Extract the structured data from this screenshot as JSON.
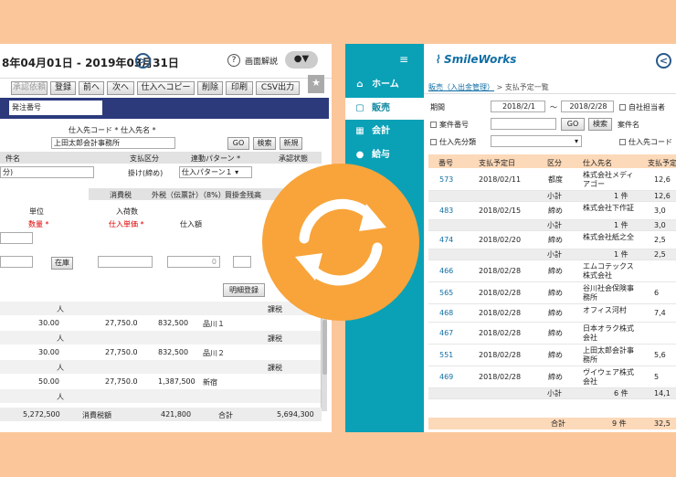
{
  "left_window": {
    "period": "8年04月01日 - 2019年03月31日",
    "help_label": "画面解説",
    "user_caret": "▼",
    "toolbar": [
      "承認依頼",
      "登録",
      "前へ",
      "次へ",
      "仕入へコピー",
      "削除",
      "印刷",
      "CSV出力"
    ],
    "order_label": "発注番号",
    "supplier_header": "仕入先コード * 仕入先名 *",
    "supplier_value": "上田太郎会計事務所",
    "go": "GO",
    "search": "検索",
    "new": "新規",
    "col_headers": [
      "件名",
      "支払区分",
      "連動パターン *",
      "承認状態"
    ],
    "case_value": "分)",
    "payment_value": "掛け(締め)",
    "pattern_value": "仕入パターン１",
    "tax_label": "消費税",
    "tax_value": "外税（伝票計）（8%）",
    "balance_label": "買掛金残高",
    "detail_headers": [
      "単位",
      "入荷数",
      "数量 *",
      "仕入単価 *",
      "仕入額"
    ],
    "stock_button": "在庫",
    "zero_value": "0",
    "detail_register": "明細登録",
    "rows": [
      {
        "unit": "人",
        "tax": "課税",
        "qty": "30.00",
        "price": "27,750.0",
        "amount": "832,500",
        "note": "品川１"
      },
      {
        "unit": "人",
        "tax": "課税",
        "qty": "30.00",
        "price": "27,750.0",
        "amount": "832,500",
        "note": "品川２"
      },
      {
        "unit": "人",
        "tax": "課税",
        "qty": "50.00",
        "price": "27,750.0",
        "amount": "1,387,500",
        "note": "新宿"
      },
      {
        "unit": "人",
        "tax": "",
        "qty": "",
        "price": "",
        "amount": "",
        "note": ""
      }
    ],
    "footer": {
      "subtotal": "5,272,500",
      "tax_label": "消費税額",
      "tax": "421,800",
      "total_label": "合計",
      "total": "5,694,300"
    }
  },
  "right_window": {
    "menu": [
      "ホーム",
      "販売",
      "会計",
      "給与"
    ],
    "logo": "SmileWorks",
    "breadcrumb_link": "販売（入出金管理）",
    "breadcrumb_rest": " > 支払予定一覧",
    "period_label": "期間",
    "date_from": "2018/2/1",
    "tilde": "～",
    "date_to": "2018/2/28",
    "own_staff": "自社担当者",
    "case_no": "案件番号",
    "go": "GO",
    "search": "検索",
    "case_name": "案件名",
    "supplier_class": "仕入先分類",
    "supplier_code": "仕入先コード",
    "headers": [
      "番号",
      "支払予定日",
      "区分",
      "仕入先名",
      "支払予定"
    ],
    "rows": [
      {
        "no": "573",
        "date": "2018/02/11",
        "kind": "都度",
        "name": "株式会社メディアゴー",
        "amt": "12,6"
      },
      {
        "sub": true,
        "label": "小計",
        "count": "1 件",
        "amt": "12,6"
      },
      {
        "no": "483",
        "date": "2018/02/15",
        "kind": "締め",
        "name": "株式会社下作証",
        "amt": "3,0"
      },
      {
        "sub": true,
        "label": "小計",
        "count": "1 件",
        "amt": "3,0"
      },
      {
        "no": "474",
        "date": "2018/02/20",
        "kind": "締め",
        "name": "株式会社紙之全",
        "amt": "2,5"
      },
      {
        "sub": true,
        "label": "小計",
        "count": "1 件",
        "amt": "2,5"
      },
      {
        "no": "466",
        "date": "2018/02/28",
        "kind": "締め",
        "name": "エムコテックス株式会社",
        "amt": ""
      },
      {
        "no": "565",
        "date": "2018/02/28",
        "kind": "締め",
        "name": "谷川社会保険事務所",
        "amt": "6"
      },
      {
        "no": "468",
        "date": "2018/02/28",
        "kind": "締め",
        "name": "オフィス河村",
        "amt": "7,4"
      },
      {
        "no": "467",
        "date": "2018/02/28",
        "kind": "締め",
        "name": "日本オラク株式会社",
        "amt": ""
      },
      {
        "no": "551",
        "date": "2018/02/28",
        "kind": "締め",
        "name": "上田太郎会計事務所",
        "amt": "5,6"
      },
      {
        "no": "469",
        "date": "2018/02/28",
        "kind": "締め",
        "name": "ヴイウェア株式会社",
        "amt": "5"
      },
      {
        "sub": true,
        "label": "小計",
        "count": "6 件",
        "amt": "14,1"
      }
    ],
    "total": {
      "label": "合計",
      "count": "9 件",
      "amt": "32,5"
    }
  },
  "colors": {
    "background": "#fbc79a",
    "sidebar": "#0aa1b7",
    "navy": "#2c3a7c",
    "badge": "#f8a43a",
    "header_row": "#fcd9b9"
  }
}
